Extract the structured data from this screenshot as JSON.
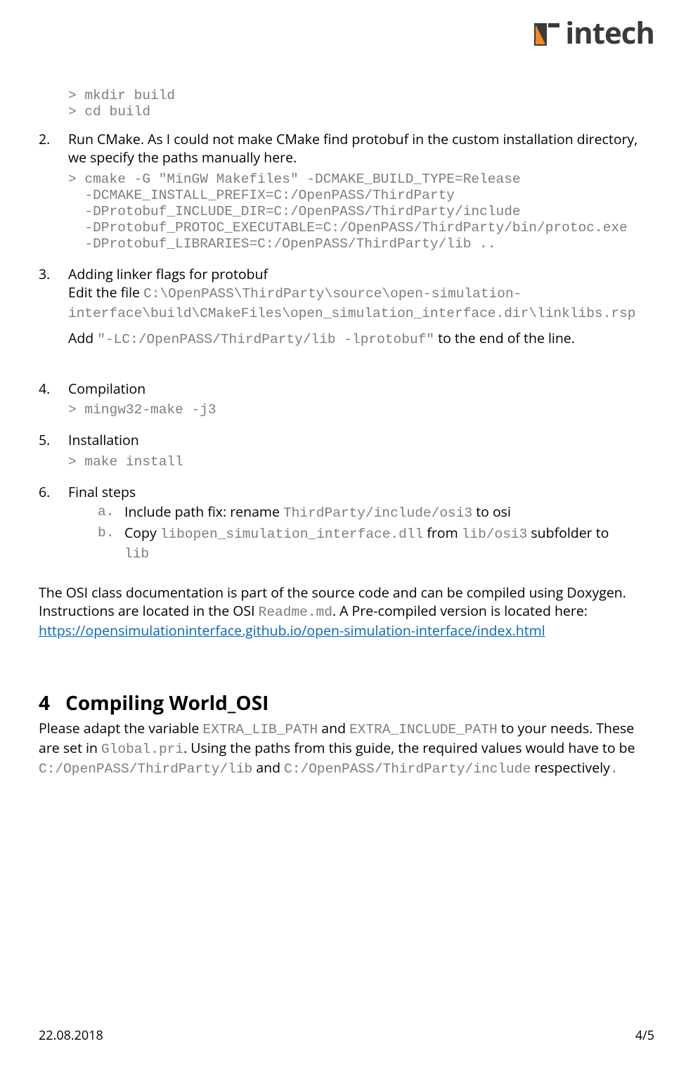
{
  "logo": {
    "text": "intech"
  },
  "code_block_1": "> mkdir build\n> cd build",
  "steps": {
    "s2": {
      "text": "Run CMake. As I could not make CMake find protobuf in the custom installation directory, we specify the paths manually here.",
      "code": "> cmake -G \"MinGW Makefiles\" -DCMAKE_BUILD_TYPE=Release\n  -DCMAKE_INSTALL_PREFIX=C:/OpenPASS/ThirdParty\n  -DProtobuf_INCLUDE_DIR=C:/OpenPASS/ThirdParty/include\n  -DProtobuf_PROTOC_EXECUTABLE=C:/OpenPASS/ThirdParty/bin/protoc.exe\n  -DProtobuf_LIBRARIES=C:/OpenPASS/ThirdParty/lib .."
    },
    "s3": {
      "title": "Adding linker flags for protobuf",
      "edit_pre": "Edit the file ",
      "edit_path": "C:\\OpenPASS\\ThirdParty\\source\\open-simulation-interface\\build\\CMakeFiles\\open_simulation_interface.dir\\linklibs.rsp",
      "add_pre": "Add ",
      "add_code": "\"-LC:/OpenPASS/ThirdParty/lib -lprotobuf\"",
      "add_post": " to the end of the line."
    },
    "s4": {
      "title": "Compilation",
      "code": "> mingw32-make -j3"
    },
    "s5": {
      "title": "Installation",
      "code": "> make install"
    },
    "s6": {
      "title": "Final steps",
      "a": {
        "marker": "a.",
        "pre": "Include path fix: rename ",
        "code": "ThirdParty/include/osi3",
        "post": " to osi"
      },
      "b": {
        "marker": "b.",
        "pre": "Copy ",
        "code1": "libopen_simulation_interface.dll",
        "mid": " from ",
        "code2": "lib/osi3",
        "post_pre": " subfolder to ",
        "code3": "lib"
      }
    }
  },
  "para_osi": {
    "t1": "The OSI class documentation is part of the source code and can be compiled using Doxygen. Instructions are located in the OSI ",
    "readme": "Readme.md",
    "t2": ". A Pre-compiled version is located here:",
    "link": "https://opensimulationinterface.github.io/open-simulation-interface/index.html"
  },
  "section4": {
    "num": "4",
    "title": "Compiling World_OSI",
    "body_1": "Please adapt the variable ",
    "v1": "EXTRA_LIB_PATH",
    "body_2": " and ",
    "v2": "EXTRA_INCLUDE_PATH",
    "body_3": " to your needs. These are set in ",
    "v3": "Global.pri",
    "body_4": ". Using the paths from this guide, the required values would have to be ",
    "v4": "C:/OpenPASS/ThirdParty/lib",
    "body_5": " and ",
    "v5": "C:/OpenPASS/ThirdParty/include",
    "body_6": " respectively",
    "body_7": "."
  },
  "footer": {
    "date": "22.08.2018",
    "page": "4/5"
  }
}
